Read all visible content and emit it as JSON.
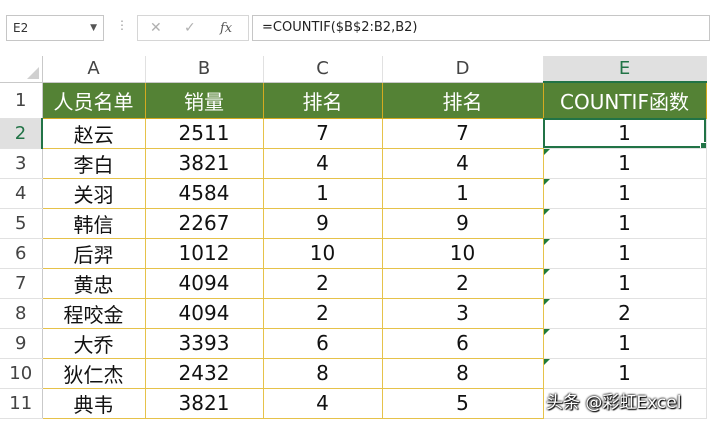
{
  "formula_bar": {
    "name_box": "E2",
    "formula": "=COUNTIF($B$2:B2,B2)"
  },
  "icons": {
    "cancel": "close-icon",
    "confirm": "check-icon",
    "function": "function-icon",
    "dropdown": "chevron-down-icon"
  },
  "columns": [
    "A",
    "B",
    "C",
    "D",
    "E"
  ],
  "rows": [
    "1",
    "2",
    "3",
    "4",
    "5",
    "6",
    "7",
    "8",
    "9",
    "10",
    "11"
  ],
  "header": [
    "人员名单",
    "销量",
    "排名",
    "排名",
    "COUNTIF函数"
  ],
  "data": [
    [
      "赵云",
      "2511",
      "7",
      "7",
      "1"
    ],
    [
      "李白",
      "3821",
      "4",
      "4",
      "1"
    ],
    [
      "关羽",
      "4584",
      "1",
      "1",
      "1"
    ],
    [
      "韩信",
      "2267",
      "9",
      "9",
      "1"
    ],
    [
      "后羿",
      "1012",
      "10",
      "10",
      "1"
    ],
    [
      "黄忠",
      "4094",
      "2",
      "2",
      "1"
    ],
    [
      "程咬金",
      "4094",
      "2",
      "3",
      "2"
    ],
    [
      "大乔",
      "3393",
      "6",
      "6",
      "1"
    ],
    [
      "狄仁杰",
      "2432",
      "8",
      "8",
      "1"
    ],
    [
      "典韦",
      "3821",
      "4",
      "5",
      ""
    ]
  ],
  "watermark": "头条 @彩虹Excel",
  "colors": {
    "header_fill": "#548235",
    "header_text": "#ffffff",
    "border_gold": "#e6c24a",
    "selection": "#217346"
  }
}
